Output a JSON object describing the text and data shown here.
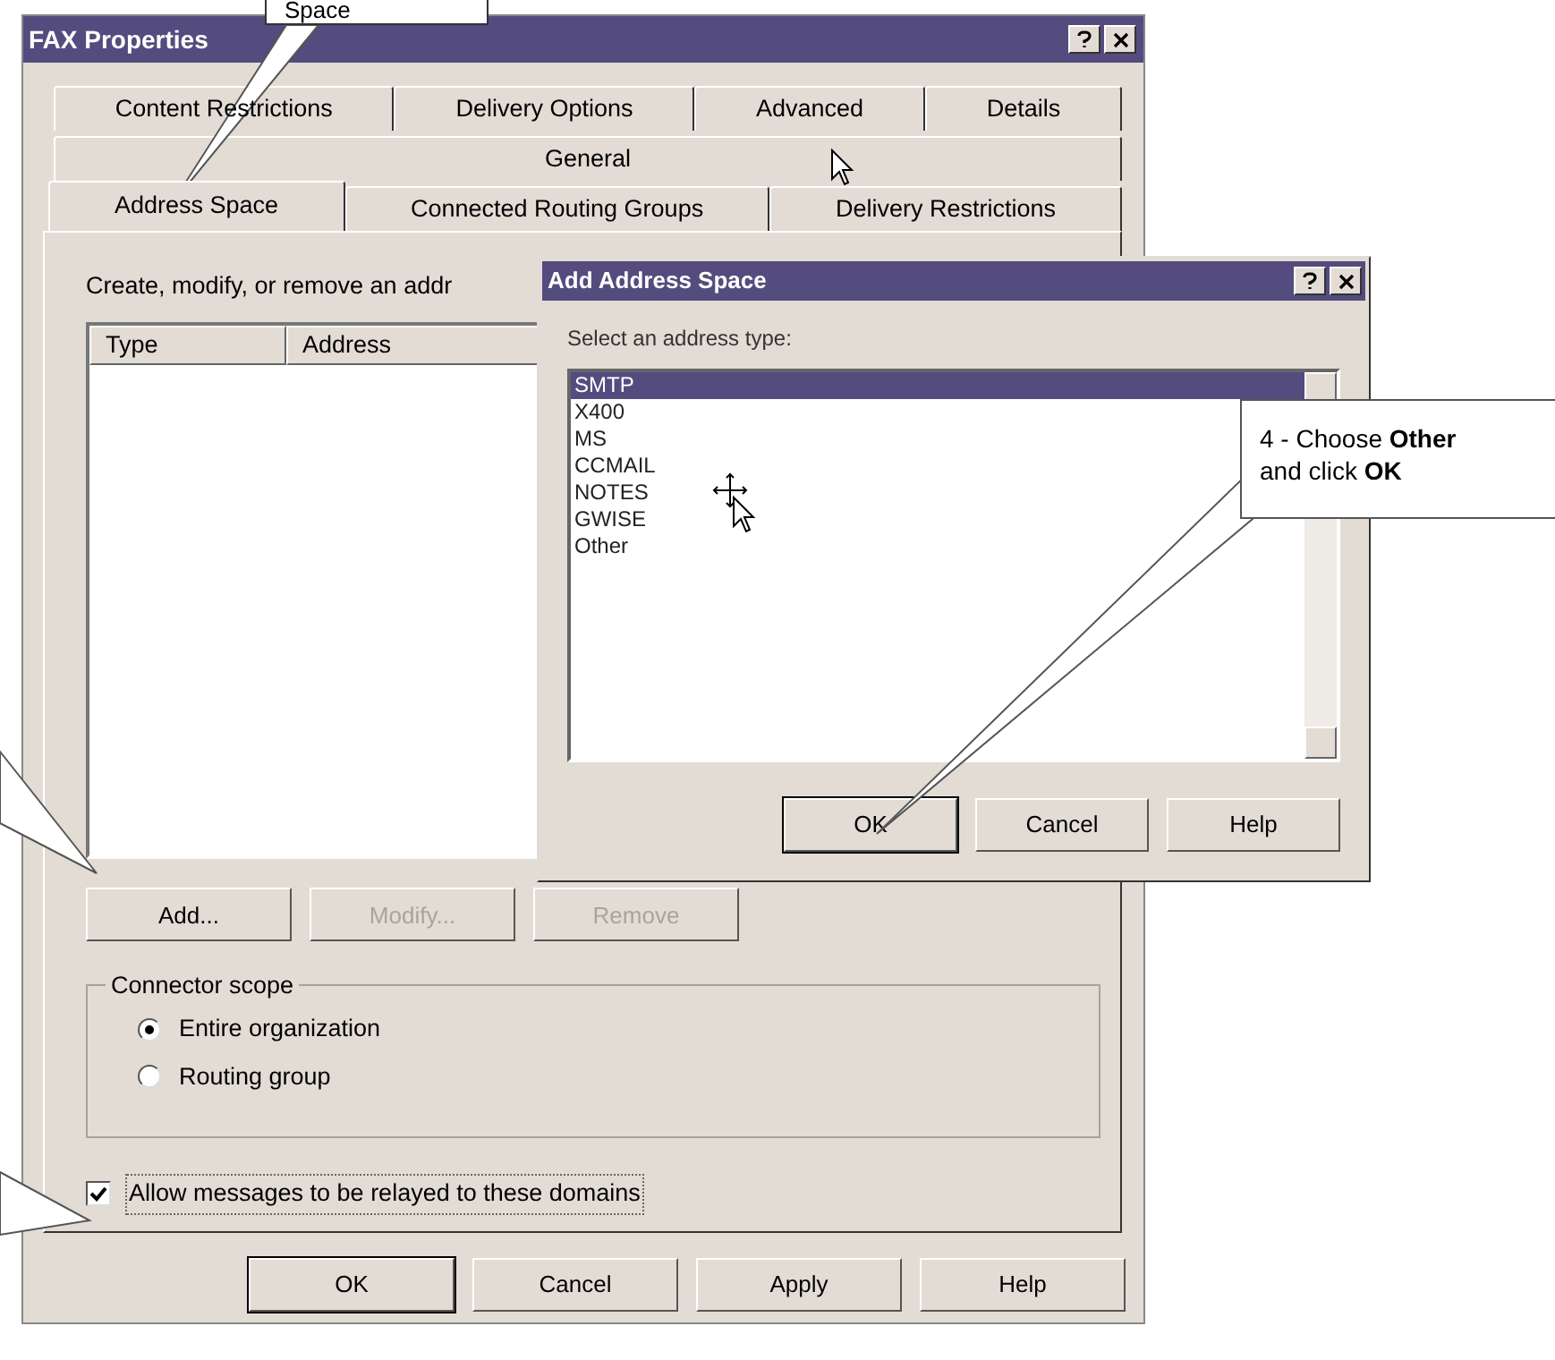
{
  "window": {
    "title": "FAX Properties"
  },
  "tab_rows": [
    [
      {
        "label": "Content Restrictions",
        "selected": false
      },
      {
        "label": "Delivery Options",
        "selected": false
      },
      {
        "label": "Advanced",
        "selected": false
      },
      {
        "label": "Details",
        "selected": false
      }
    ],
    [
      {
        "label": "General",
        "selected": false
      }
    ],
    [
      {
        "label": "Address Space",
        "selected": true
      },
      {
        "label": "Connected Routing Groups",
        "selected": false
      },
      {
        "label": "Delivery Restrictions",
        "selected": false
      }
    ]
  ],
  "description": "Create, modify, or remove an addr",
  "list": {
    "columns": [
      "Type",
      "Address"
    ]
  },
  "list_buttons": [
    {
      "label": "Add...",
      "disabled": false
    },
    {
      "label": "Modify...",
      "disabled": true
    },
    {
      "label": "Remove",
      "disabled": true
    }
  ],
  "scope": {
    "title": "Connector scope",
    "options": [
      {
        "label": "Entire organization",
        "selected": true
      },
      {
        "label": "Routing group",
        "selected": false
      }
    ]
  },
  "relay": {
    "label": "Allow messages to be relayed to these domains",
    "checked": true
  },
  "buttons": [
    "OK",
    "Cancel",
    "Apply",
    "Help"
  ],
  "dialog": {
    "title": "Add Address Space",
    "label": "Select an address type:",
    "items": [
      {
        "label": "SMTP",
        "selected": true
      },
      {
        "label": "X400",
        "selected": false
      },
      {
        "label": "MS",
        "selected": false
      },
      {
        "label": "CCMAIL",
        "selected": false
      },
      {
        "label": "NOTES",
        "selected": false
      },
      {
        "label": "GWISE",
        "selected": false
      },
      {
        "label": "Other",
        "selected": false
      }
    ],
    "buttons": [
      "OK",
      "Cancel",
      "Help"
    ]
  },
  "callouts": [
    {
      "text": "Space"
    },
    {
      "text": "4 - Choose **Other** and click **OK**"
    }
  ]
}
